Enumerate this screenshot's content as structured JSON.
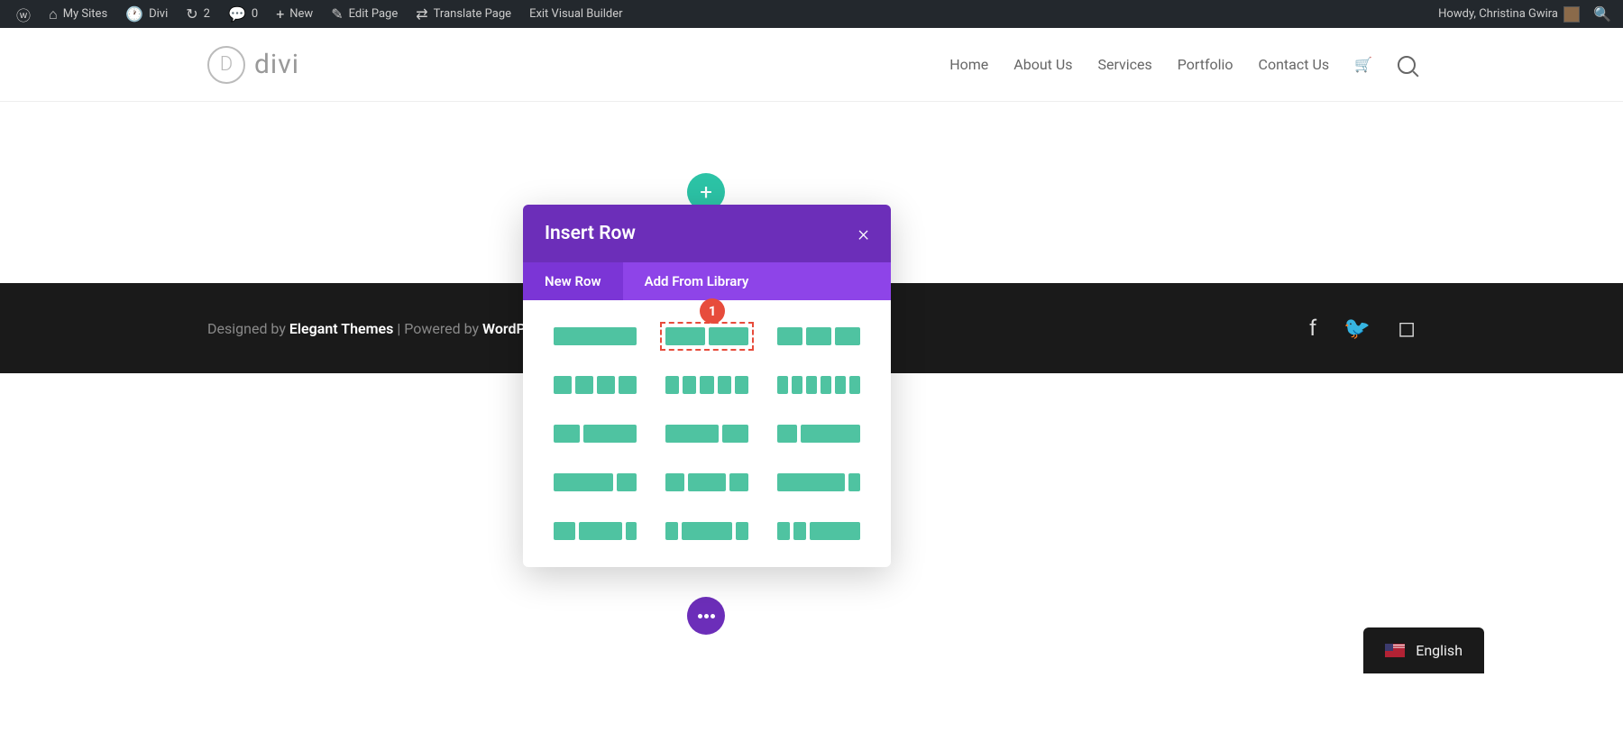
{
  "adminbar": {
    "my_sites": "My Sites",
    "site_name": "Divi",
    "updates_count": "2",
    "comments_count": "0",
    "new_label": "New",
    "edit_page": "Edit Page",
    "translate_page": "Translate Page",
    "exit_builder": "Exit Visual Builder",
    "howdy": "Howdy, Christina Gwira"
  },
  "header": {
    "logo_text": "divi",
    "nav": [
      "Home",
      "About Us",
      "Services",
      "Portfolio",
      "Contact Us"
    ]
  },
  "footer": {
    "designed_by": "Designed by ",
    "theme_link": "Elegant Themes",
    "sep": " | Powered by ",
    "platform_link": "WordPr"
  },
  "modal": {
    "title": "Insert Row",
    "tab_new": "New Row",
    "tab_library": "Add From Library",
    "callout_num": "1"
  },
  "lang": {
    "label": "English"
  }
}
